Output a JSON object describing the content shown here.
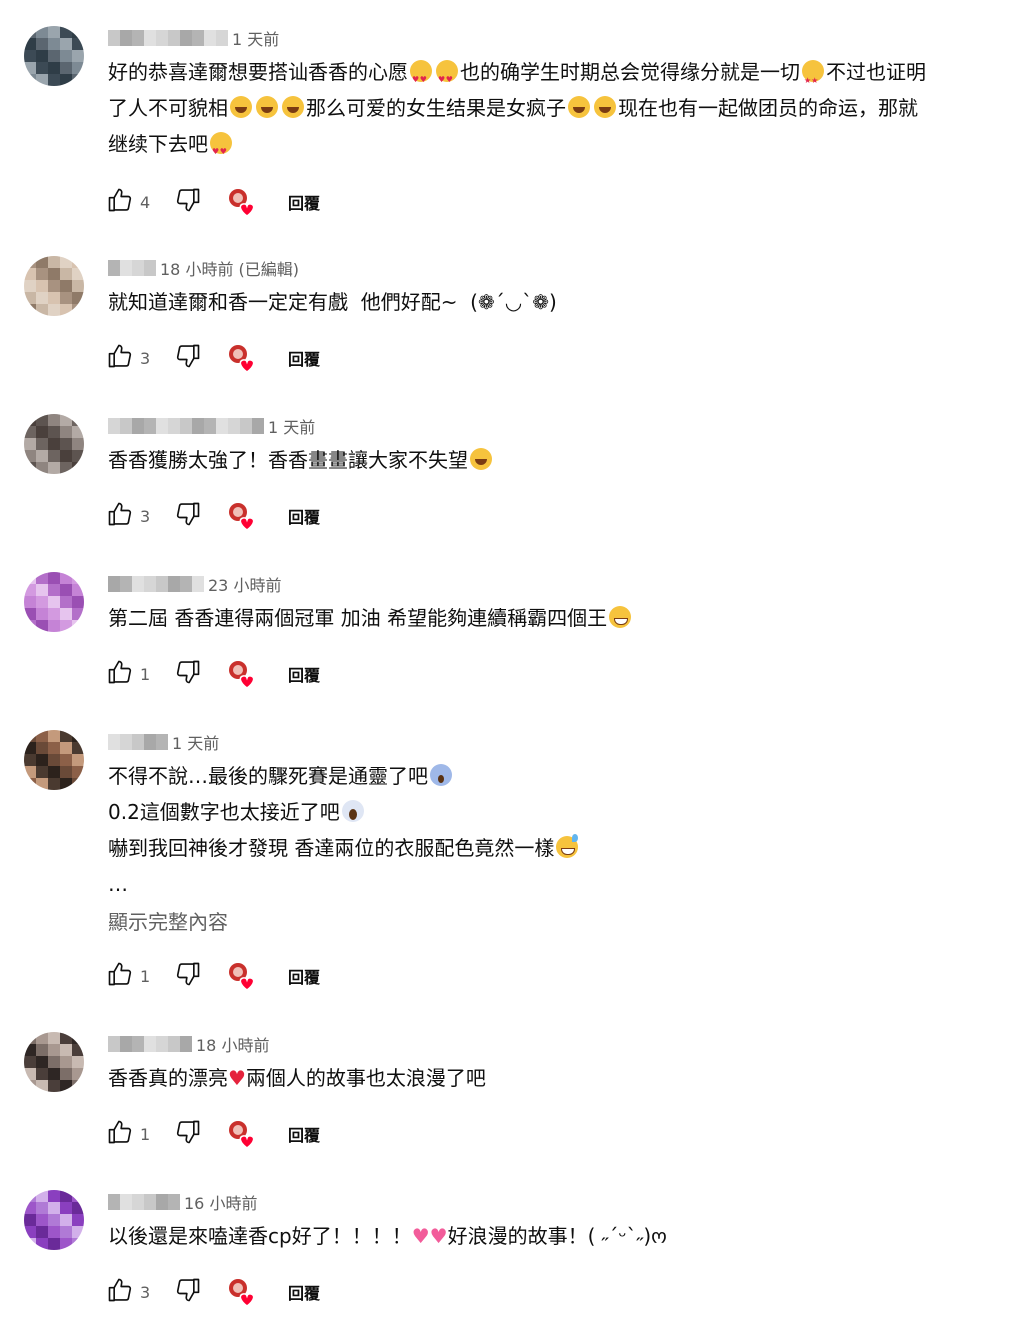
{
  "actions": {
    "reply_label": "回覆",
    "like_icon": "thumbs-up-icon",
    "dislike_icon": "thumbs-down-icon",
    "creator_heart_icon": "creator-heart-icon"
  },
  "colors": {
    "text": "#0f0f0f",
    "secondary": "#606060",
    "heart": "#ff0033"
  },
  "comments": [
    {
      "time": "1 天前",
      "body": [
        [
          {
            "t": "text",
            "v": "好的恭喜達爾想要搭讪香香的心愿"
          },
          {
            "t": "emoji",
            "v": "heart-eyes"
          },
          {
            "t": "emoji",
            "v": "heart-eyes"
          },
          {
            "t": "text",
            "v": "也的确学生时期总会觉得缘分就是一切"
          },
          {
            "t": "emoji",
            "v": "star-eyes"
          },
          {
            "t": "text",
            "v": "不过也证明了人不可貌相"
          },
          {
            "t": "emoji",
            "v": "laugh"
          },
          {
            "t": "emoji",
            "v": "laugh"
          },
          {
            "t": "emoji",
            "v": "laugh"
          },
          {
            "t": "text",
            "v": "那么可爱的女生结果是女疯子"
          },
          {
            "t": "emoji",
            "v": "laugh"
          },
          {
            "t": "emoji",
            "v": "laugh"
          },
          {
            "t": "text",
            "v": "现在也有一起做团员的命运，那就继续下去吧"
          },
          {
            "t": "emoji",
            "v": "heart-eyes"
          }
        ]
      ],
      "likes": "4"
    },
    {
      "time": "18 小時前 (已編輯)",
      "body": [
        [
          {
            "t": "text",
            "v": "就知道達爾和香一定定有戲  他們好配~  (❁´◡`❁)"
          }
        ]
      ],
      "likes": "3"
    },
    {
      "time": "1 天前",
      "body": [
        [
          {
            "t": "text",
            "v": "香香獲勝太強了！香香畫畫讓大家不失望"
          },
          {
            "t": "emoji",
            "v": "laugh"
          }
        ]
      ],
      "likes": "3"
    },
    {
      "time": "23 小時前",
      "body": [
        [
          {
            "t": "text",
            "v": "第二屆 香香連得兩個冠軍 加油 希望能夠連續稱霸四個王"
          },
          {
            "t": "emoji",
            "v": "grin"
          }
        ]
      ],
      "likes": "1"
    },
    {
      "time": "1 天前",
      "body": [
        [
          {
            "t": "text",
            "v": "不得不說…最後的驟死賽是通靈了吧"
          },
          {
            "t": "emoji",
            "v": "fear"
          }
        ],
        [
          {
            "t": "text",
            "v": "0.2這個數字也太接近了吧"
          },
          {
            "t": "emoji",
            "v": "scream"
          }
        ],
        [
          {
            "t": "text",
            "v": "嚇到我回神後才發現 香達兩位的衣服配色竟然一樣"
          },
          {
            "t": "emoji",
            "v": "sweat"
          }
        ],
        [
          {
            "t": "text",
            "v": "…"
          }
        ]
      ],
      "more": "顯示完整內容",
      "likes": "1"
    },
    {
      "time": "18 小時前",
      "body": [
        [
          {
            "t": "text",
            "v": "香香真的漂亮"
          },
          {
            "t": "heart",
            "v": "red"
          },
          {
            "t": "text",
            "v": "兩個人的故事也太浪漫了吧"
          }
        ]
      ],
      "likes": "1"
    },
    {
      "time": "16 小時前",
      "body": [
        [
          {
            "t": "text",
            "v": "以後還是來嗑達香cp好了！！！！"
          },
          {
            "t": "heart",
            "v": "pink"
          },
          {
            "t": "heart",
            "v": "pink"
          },
          {
            "t": "text",
            "v": "好浪漫的故事！( ˶ˊᵕˋ˶)ო"
          }
        ]
      ],
      "likes": "3"
    }
  ]
}
